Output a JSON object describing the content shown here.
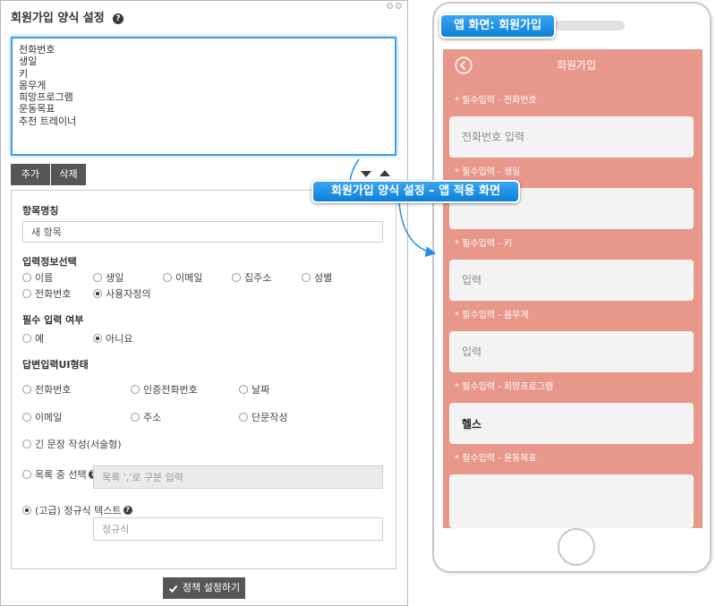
{
  "settings_panel": {
    "title": "회원가입 양식 설정",
    "form_items_text": "전화번호\n생일\n키\n몸무게\n희망프로그램\n운동목표\n추천 트레이너",
    "add_label": "추가",
    "delete_label": "삭제",
    "item_name": {
      "label": "항목명칭",
      "value": "새 항목"
    },
    "input_info": {
      "label": "입력정보선택",
      "options": [
        {
          "label": "이름",
          "checked": false
        },
        {
          "label": "생일",
          "checked": false
        },
        {
          "label": "이메일",
          "checked": false
        },
        {
          "label": "집주소",
          "checked": false
        },
        {
          "label": "성별",
          "checked": false
        },
        {
          "label": "전화번호",
          "checked": false
        },
        {
          "label": "사용자정의",
          "checked": true
        }
      ]
    },
    "required": {
      "label": "필수 입력 여부",
      "options": [
        {
          "label": "예",
          "checked": false
        },
        {
          "label": "아니요",
          "checked": true
        }
      ]
    },
    "answer_ui": {
      "label": "답변입력UI형태",
      "options": [
        {
          "label": "전화번호",
          "checked": false
        },
        {
          "label": "인증전화번호",
          "checked": false
        },
        {
          "label": "날짜",
          "checked": false
        },
        {
          "label": "이메일",
          "checked": false
        },
        {
          "label": "주소",
          "checked": false
        },
        {
          "label": "단문작성",
          "checked": false
        },
        {
          "label": "긴 문장 작성(서술형)",
          "checked": false
        },
        {
          "label": "목록 중 선택",
          "checked": false
        },
        {
          "label": "(고급) 정규식 텍스트",
          "checked": true
        }
      ],
      "list_placeholder": "목록 ','로 구분 입력",
      "regex_placeholder": "정규식"
    },
    "submit_label": "정책 설정하기"
  },
  "callout": {
    "text": "회원가입 양식 설정 – 앱 적용 화면"
  },
  "phone": {
    "badge": "앱 화면: 회원가입",
    "header_title": "회원가입",
    "fields": [
      {
        "label": "* 필수입력 - 전화번호",
        "placeholder": "전화번호 입력"
      },
      {
        "label": "* 필수입력 - 생일"
      },
      {
        "label": "* 필수입력 - 키",
        "placeholder": "입력"
      },
      {
        "label": "* 필수입력 - 몸무게",
        "placeholder": "입력"
      },
      {
        "label": "* 필수입력 - 희망프로그램",
        "value": "헬스"
      },
      {
        "label": "* 필수입력 - 운동목표"
      }
    ]
  },
  "icons": {
    "help": "question-circle-icon",
    "move_down": "triangle-down-icon",
    "move_up": "triangle-up-icon",
    "submit": "check-icon",
    "back": "back-circle-icon",
    "window_controls": "window-control-icon"
  },
  "colors": {
    "accent_blue": "#0c7fd8",
    "textarea_focus": "#3c9fe4",
    "dark_button": "#565656",
    "app_screen_bg": "#e8978b",
    "app_input_bg": "#f3f3f3"
  }
}
